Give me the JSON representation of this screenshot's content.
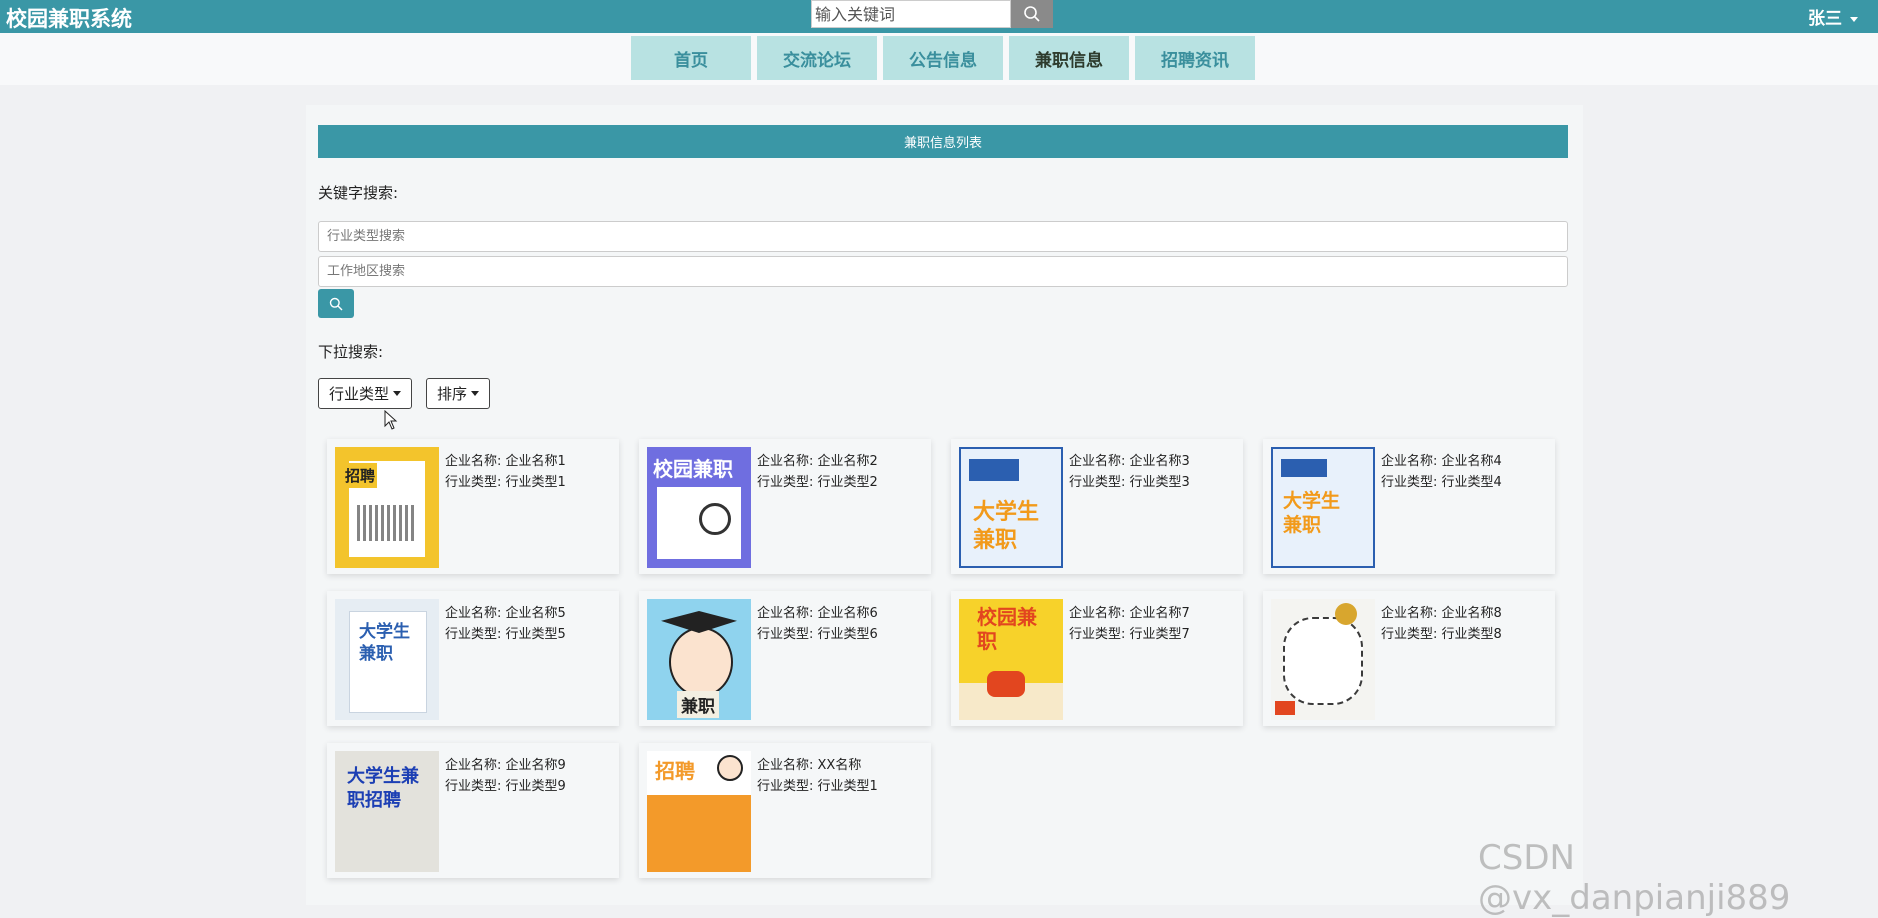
{
  "app": {
    "brand": "校园兼职系统",
    "user": "张三"
  },
  "top_search": {
    "placeholder": "输入关键词"
  },
  "nav": [
    "首页",
    "交流论坛",
    "公告信息",
    "兼职信息",
    "招聘资讯"
  ],
  "list": {
    "header": "兼职信息列表",
    "keyword_label": "关键字搜索:",
    "industry_placeholder": "行业类型搜索",
    "area_placeholder": "工作地区搜索",
    "dropdown_label": "下拉搜索:",
    "dropdowns": [
      "行业类型",
      "排序"
    ]
  },
  "cards": [
    {
      "company": "企业名称: 企业名称1",
      "industry": "行业类型: 行业类型1",
      "thumb_title": "招聘",
      "thumb_bg": "#f3c42c"
    },
    {
      "company": "企业名称: 企业名称2",
      "industry": "行业类型: 行业类型2",
      "thumb_title": "校园兼职",
      "thumb_bg": "#6f6ee0"
    },
    {
      "company": "企业名称: 企业名称3",
      "industry": "行业类型: 行业类型3",
      "thumb_title": "大学生兼职",
      "thumb_bg": "#e8f1fb"
    },
    {
      "company": "企业名称: 企业名称4",
      "industry": "行业类型: 行业类型4",
      "thumb_title": "大学生兼职",
      "thumb_bg": "#e8f1fb"
    },
    {
      "company": "企业名称: 企业名称5",
      "industry": "行业类型: 行业类型5",
      "thumb_title": "大学生兼职",
      "thumb_bg": "#e6edf3"
    },
    {
      "company": "企业名称: 企业名称6",
      "industry": "行业类型: 行业类型6",
      "thumb_title": "兼职",
      "thumb_bg": "#8fd3ee"
    },
    {
      "company": "企业名称: 企业名称7",
      "industry": "行业类型: 行业类型7",
      "thumb_title": "校园兼职",
      "thumb_bg": "#f7d22a"
    },
    {
      "company": "企业名称: 企业名称8",
      "industry": "行业类型: 行业类型8",
      "thumb_title": "",
      "thumb_bg": "#f4f4f1"
    },
    {
      "company": "企业名称: 企业名称9",
      "industry": "行业类型: 行业类型9",
      "thumb_title": "大学生兼职招聘",
      "thumb_bg": "#e3e2dc"
    },
    {
      "company": "企业名称: XX名称",
      "industry": "行业类型: 行业类型1",
      "thumb_title": "招聘",
      "thumb_bg": "#f39a2a"
    }
  ],
  "watermark": "CSDN @vx_danpianji889",
  "colors": {
    "accent": "#3a97a6",
    "nav_bg": "#b8e2e2",
    "page_bg": "#f0f1f3"
  },
  "icons": [
    "search-icon",
    "caret-down-icon",
    "cursor-icon"
  ]
}
